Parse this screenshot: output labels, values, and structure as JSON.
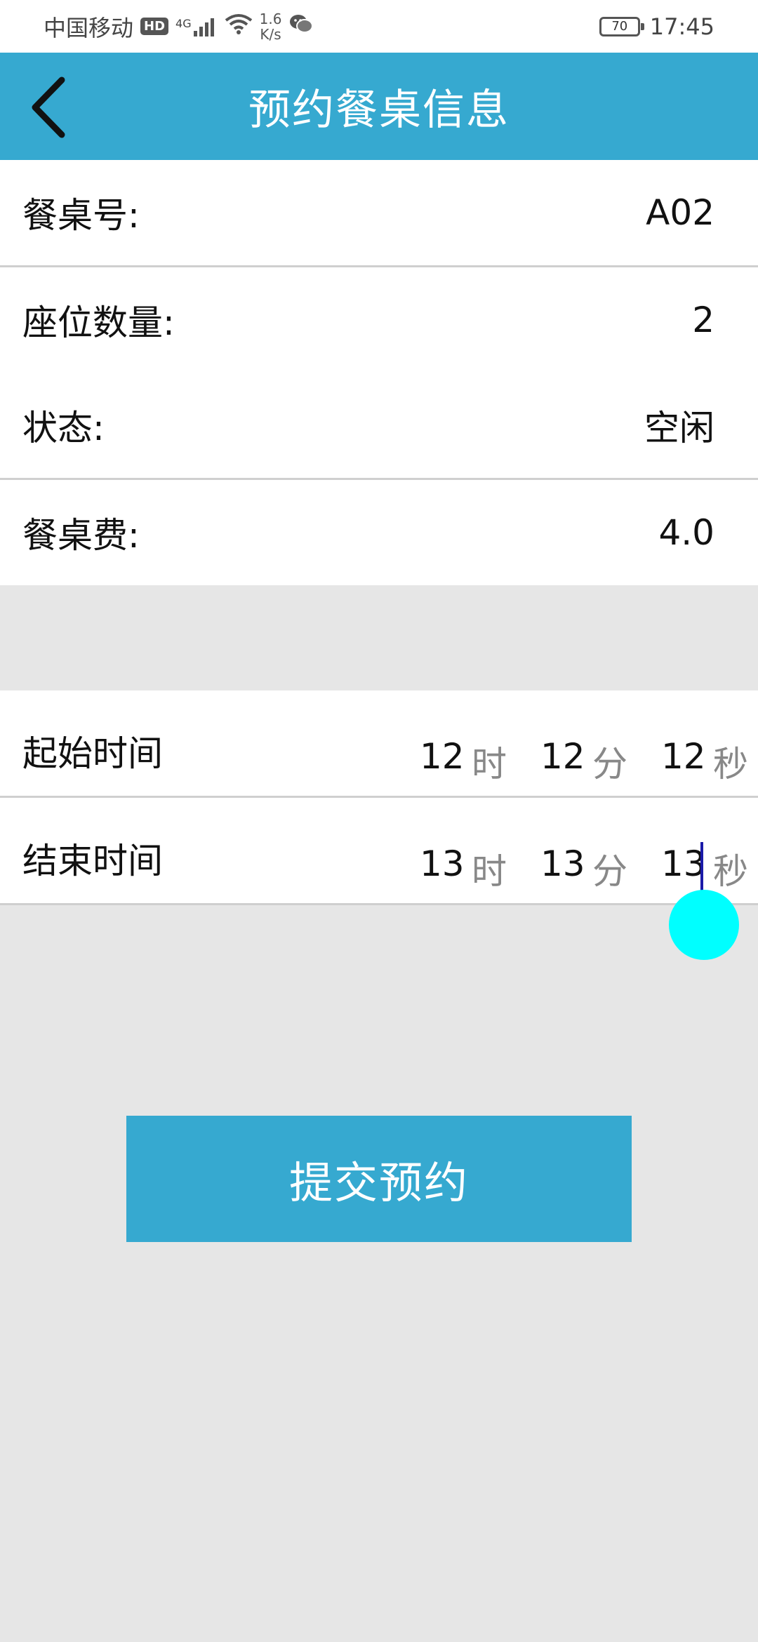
{
  "status_bar": {
    "carrier": "中国移动",
    "hd": "HD",
    "network": "4G",
    "speed_value": "1.6",
    "speed_unit": "K/s",
    "battery": "70",
    "time": "17:45"
  },
  "header": {
    "title": "预约餐桌信息"
  },
  "details": {
    "table_label": "餐桌号:",
    "table_value": "A02",
    "seats_label": "座位数量:",
    "seats_value": "2",
    "status_label": "状态:",
    "status_value": "空闲",
    "fee_label": "餐桌费:",
    "fee_value": "4.0"
  },
  "start_time": {
    "label": "起始时间",
    "hour": "12",
    "minute": "12",
    "second": "12"
  },
  "end_time": {
    "label": "结束时间",
    "hour": "13",
    "minute": "13",
    "second": "13"
  },
  "units": {
    "hour": "时",
    "minute": "分",
    "second": "秒"
  },
  "submit_label": "提交预约",
  "colors": {
    "accent": "#36a9d0",
    "background": "#e6e6e6",
    "touch_indicator": "#00ffff"
  }
}
